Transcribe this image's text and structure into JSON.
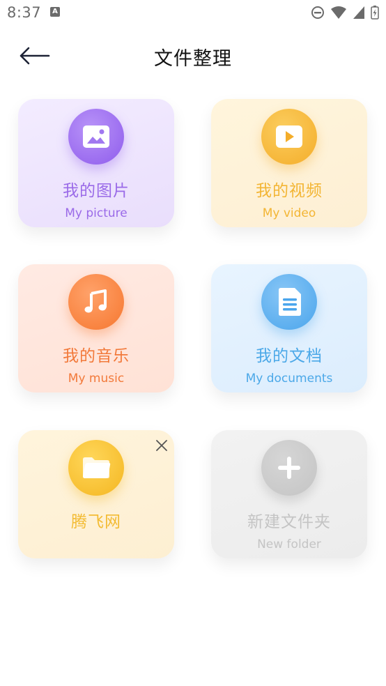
{
  "status_bar": {
    "time": "8:37",
    "notification_icon_label": "A",
    "icons": [
      "do-not-disturb-icon",
      "wifi-icon",
      "cellular-icon",
      "battery-icon"
    ]
  },
  "header": {
    "title": "文件整理",
    "back_icon": "back-arrow-icon"
  },
  "cards": {
    "picture": {
      "title": "我的图片",
      "subtitle": "My picture",
      "icon": "image-icon",
      "color": "#a178f0"
    },
    "video": {
      "title": "我的视频",
      "subtitle": "My video",
      "icon": "play-icon",
      "color": "#f6b93b"
    },
    "music": {
      "title": "我的音乐",
      "subtitle": "My music",
      "icon": "music-note-icon",
      "color": "#f8894a"
    },
    "documents": {
      "title": "我的文档",
      "subtitle": "My documents",
      "icon": "document-icon",
      "color": "#5fb2ee"
    },
    "custom": {
      "title": "腾飞网",
      "icon": "folder-icon",
      "close_icon": "close-icon",
      "color": "#f6bf2a"
    },
    "new_folder": {
      "title": "新建文件夹",
      "subtitle": "New folder",
      "icon": "plus-icon",
      "color": "#cccccc"
    }
  }
}
